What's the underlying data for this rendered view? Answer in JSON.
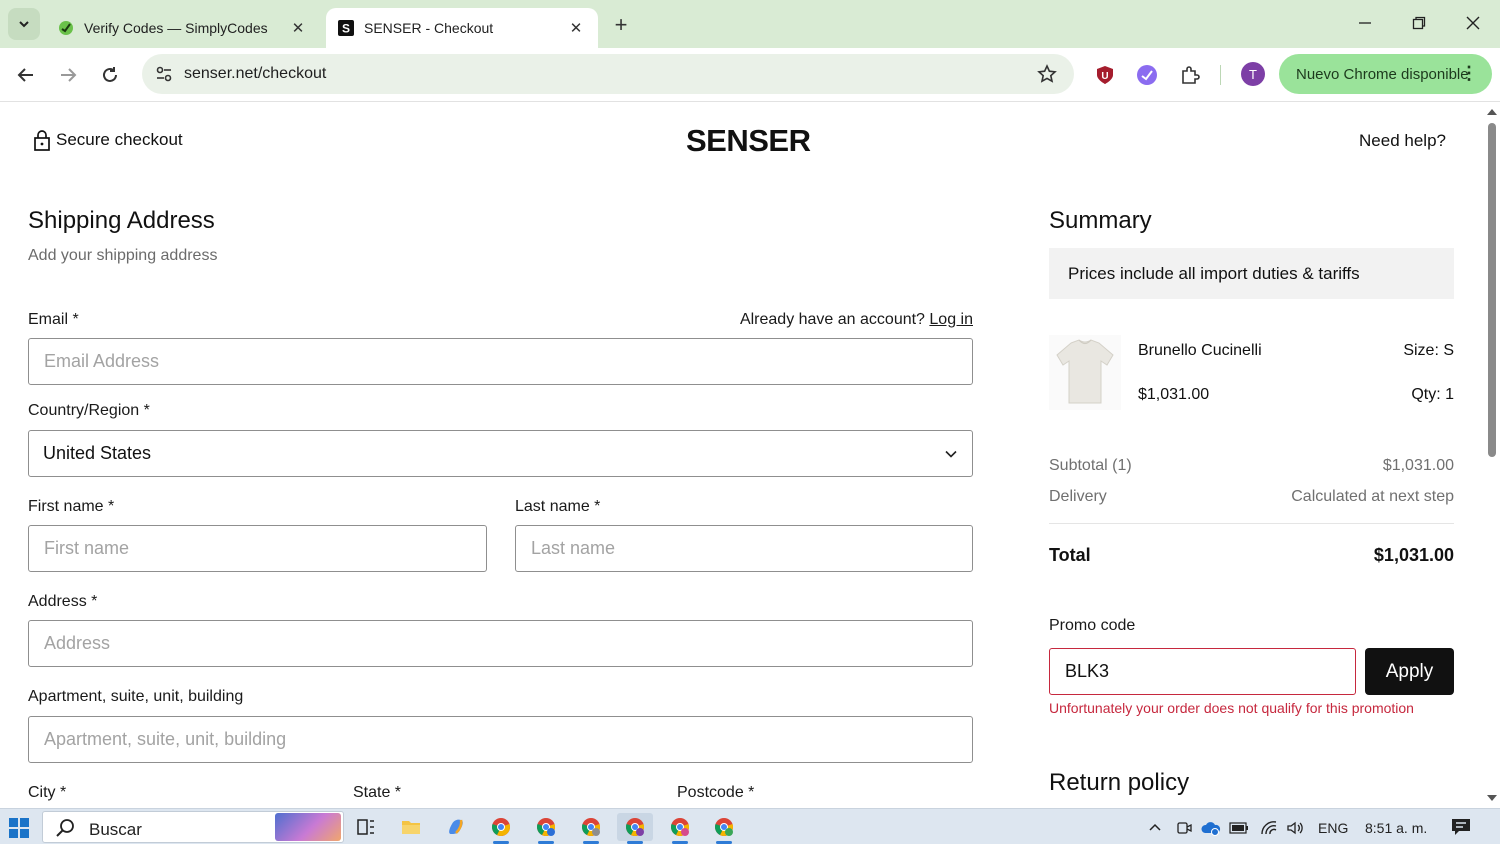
{
  "browser": {
    "tabs": [
      {
        "title": "Verify Codes — SimplyCodes",
        "active": false
      },
      {
        "title": "SENSER - Checkout",
        "active": true
      }
    ],
    "url": "senser.net/checkout",
    "profile_initial": "T",
    "update_label": "Nuevo Chrome disponible"
  },
  "header": {
    "secure_label": "Secure checkout",
    "brand": "SENSER",
    "help_label": "Need help?"
  },
  "shipping": {
    "title": "Shipping Address",
    "subtitle": "Add your shipping address",
    "email_label": "Email *",
    "account_prompt": "Already have an account?",
    "login_link": "Log in",
    "email_placeholder": "Email Address",
    "country_label": "Country/Region *",
    "country_value": "United States",
    "first_name_label": "First name *",
    "first_name_placeholder": "First name",
    "last_name_label": "Last name *",
    "last_name_placeholder": "Last name",
    "address_label": "Address *",
    "address_placeholder": "Address",
    "apartment_label": "Apartment, suite, unit, building",
    "apartment_placeholder": "Apartment, suite, unit, building",
    "city_label": "City *",
    "state_label": "State *",
    "postcode_label": "Postcode *"
  },
  "summary": {
    "title": "Summary",
    "tariff_note": "Prices include all import duties & tariffs",
    "product": {
      "name": "Brunello Cucinelli",
      "price": "$1,031.00",
      "size": "Size: S",
      "qty": "Qty: 1"
    },
    "subtotal_label": "Subtotal (1)",
    "subtotal_value": "$1,031.00",
    "delivery_label": "Delivery",
    "delivery_value": "Calculated at next step",
    "total_label": "Total",
    "total_value": "$1,031.00",
    "promo_label": "Promo code",
    "promo_value": "BLK3",
    "apply_label": "Apply",
    "promo_error": "Unfortunately your order does not qualify for this promotion",
    "return_policy_title": "Return policy"
  },
  "taskbar": {
    "search_label": "Buscar",
    "language": "ENG",
    "time": "8:51 a. m."
  },
  "colors": {
    "tabbar_bg": "#d9ebd4",
    "update_pill": "#9ae39a",
    "error_red": "#c6283e",
    "button_black": "#111111"
  }
}
